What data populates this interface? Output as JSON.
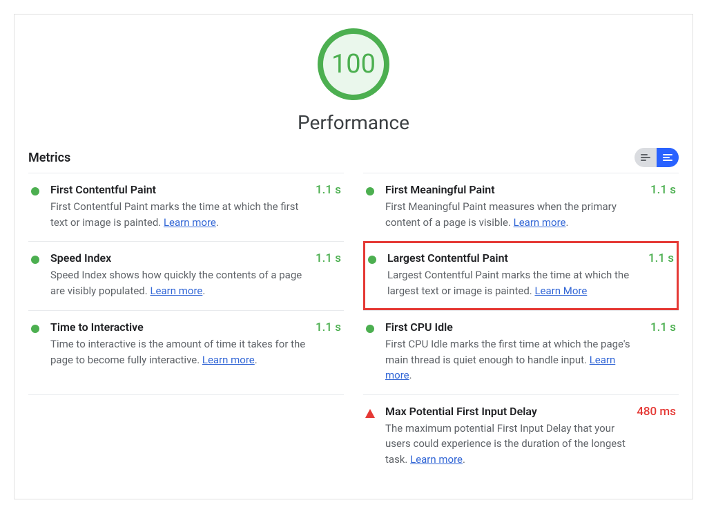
{
  "header": {
    "score": "100",
    "title": "Performance"
  },
  "metricsLabel": "Metrics",
  "learnMorePeriod": ".",
  "metrics": {
    "fcp": {
      "title": "First Contentful Paint",
      "desc": "First Contentful Paint marks the time at which the first text or image is painted. ",
      "link": "Learn more",
      "value": "1.1 s"
    },
    "fmp": {
      "title": "First Meaningful Paint",
      "desc": "First Meaningful Paint measures when the primary content of a page is visible. ",
      "link": "Learn more",
      "value": "1.1 s"
    },
    "si": {
      "title": "Speed Index",
      "desc": "Speed Index shows how quickly the contents of a page are visibly populated. ",
      "link": "Learn more",
      "value": "1.1 s"
    },
    "lcp": {
      "title": "Largest Contentful Paint",
      "desc": "Largest Contentful Paint marks the time at which the largest text or image is painted. ",
      "link": "Learn More",
      "value": "1.1 s"
    },
    "tti": {
      "title": "Time to Interactive",
      "desc": "Time to interactive is the amount of time it takes for the page to become fully interactive. ",
      "link": "Learn more",
      "value": "1.1 s"
    },
    "fci": {
      "title": "First CPU Idle",
      "desc": "First CPU Idle marks the first time at which the page's main thread is quiet enough to handle input. ",
      "link": "Learn more",
      "value": "1.1 s"
    },
    "mpfid": {
      "title": "Max Potential First Input Delay",
      "desc": "The maximum potential First Input Delay that your users could experience is the duration of the longest task. ",
      "link": "Learn more",
      "value": "480 ms"
    }
  }
}
